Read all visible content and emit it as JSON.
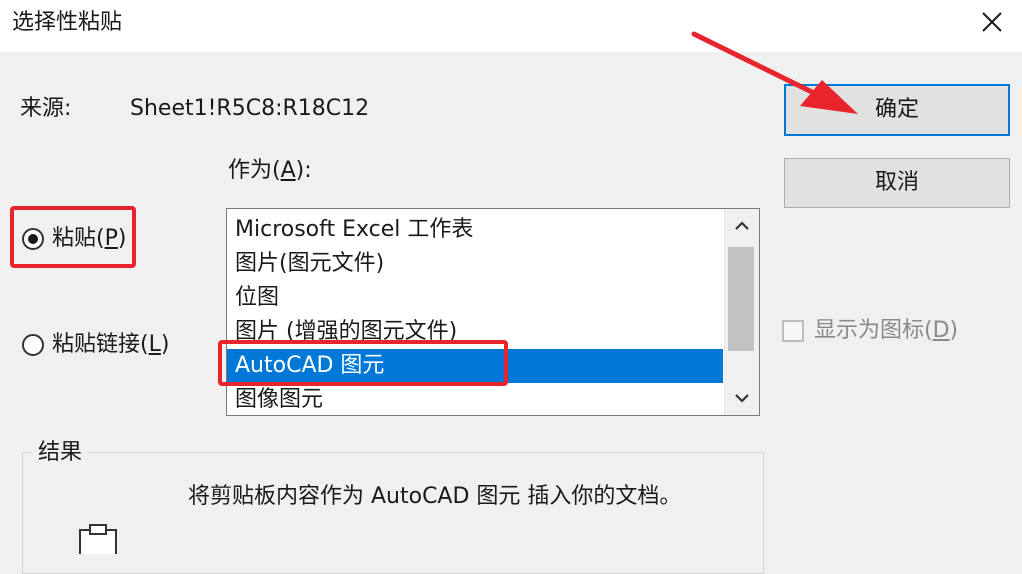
{
  "window": {
    "title": "选择性粘贴",
    "close_icon": "close-icon"
  },
  "source": {
    "label": "来源:",
    "value": "Sheet1!R5C8:R18C12"
  },
  "as_label": {
    "prefix": "作为(",
    "key": "A",
    "suffix": "):"
  },
  "buttons": {
    "ok": "确定",
    "cancel": "取消"
  },
  "radios": {
    "paste": {
      "prefix": "粘贴(",
      "key": "P",
      "suffix": ")",
      "checked": true
    },
    "paste_link": {
      "prefix": "粘贴链接(",
      "key": "L",
      "suffix": ")",
      "checked": false
    }
  },
  "list": {
    "items": [
      "Microsoft Excel 工作表",
      "图片(图元文件)",
      "位图",
      "图片 (增强的图元文件)",
      "AutoCAD 图元",
      "图像图元"
    ],
    "selected_index": 4
  },
  "display_as_icon": {
    "prefix": "显示为图标(",
    "key": "D",
    "suffix": ")",
    "checked": false
  },
  "result": {
    "title": "结果",
    "text": "将剪贴板内容作为 AutoCAD 图元 插入你的文档。",
    "icon": "clipboard-icon"
  },
  "colors": {
    "annotation_red": "#e8242c",
    "selection_blue": "#0078d7"
  }
}
